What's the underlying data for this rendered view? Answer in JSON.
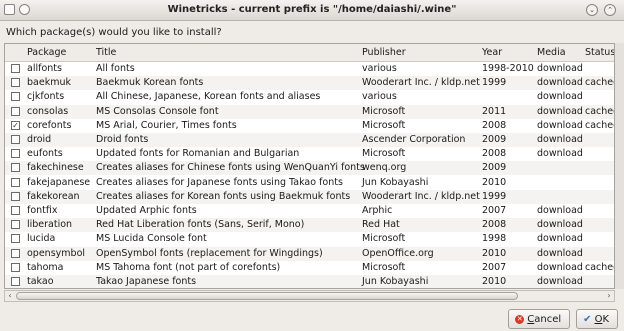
{
  "window": {
    "title": "Winetricks - current prefix is \"/home/daiashi/.wine\""
  },
  "prompt": "Which package(s) would you like to install?",
  "columns": {
    "package": "Package",
    "title": "Title",
    "publisher": "Publisher",
    "year": "Year",
    "media": "Media",
    "status": "Status"
  },
  "rows": [
    {
      "checked": false,
      "package": "allfonts",
      "title": "All fonts",
      "publisher": "various",
      "year": "1998-2010",
      "media": "download",
      "status": ""
    },
    {
      "checked": false,
      "package": "baekmuk",
      "title": "Baekmuk Korean fonts",
      "publisher": "Wooderart Inc. / kldp.net",
      "year": "1999",
      "media": "download",
      "status": "cached"
    },
    {
      "checked": false,
      "package": "cjkfonts",
      "title": "All Chinese, Japanese, Korean fonts and aliases",
      "publisher": "various",
      "year": "",
      "media": "download",
      "status": ""
    },
    {
      "checked": false,
      "package": "consolas",
      "title": "MS Consolas Console font",
      "publisher": "Microsoft",
      "year": "2011",
      "media": "download",
      "status": "cached"
    },
    {
      "checked": true,
      "package": "corefonts",
      "title": "MS Arial, Courier, Times fonts",
      "publisher": "Microsoft",
      "year": "2008",
      "media": "download",
      "status": "cached"
    },
    {
      "checked": false,
      "package": "droid",
      "title": "Droid fonts",
      "publisher": "Ascender Corporation",
      "year": "2009",
      "media": "download",
      "status": ""
    },
    {
      "checked": false,
      "package": "eufonts",
      "title": "Updated fonts for Romanian and Bulgarian",
      "publisher": "Microsoft",
      "year": "2008",
      "media": "download",
      "status": ""
    },
    {
      "checked": false,
      "package": "fakechinese",
      "title": "Creates aliases for Chinese fonts using WenQuanYi fonts",
      "publisher": "wenq.org",
      "year": "2009",
      "media": "",
      "status": ""
    },
    {
      "checked": false,
      "package": "fakejapanese",
      "title": "Creates aliases for Japanese fonts using Takao fonts",
      "publisher": "Jun Kobayashi",
      "year": "2010",
      "media": "",
      "status": ""
    },
    {
      "checked": false,
      "package": "fakekorean",
      "title": "Creates aliases for Korean fonts using Baekmuk fonts",
      "publisher": "Wooderart Inc. / kldp.net",
      "year": "1999",
      "media": "",
      "status": ""
    },
    {
      "checked": false,
      "package": "fontfix",
      "title": "Updated Arphic fonts",
      "publisher": "Arphic",
      "year": "2007",
      "media": "download",
      "status": ""
    },
    {
      "checked": false,
      "package": "liberation",
      "title": "Red Hat Liberation fonts (Sans, Serif, Mono)",
      "publisher": "Red Hat",
      "year": "2008",
      "media": "download",
      "status": ""
    },
    {
      "checked": false,
      "package": "lucida",
      "title": "MS Lucida Console font",
      "publisher": "Microsoft",
      "year": "1998",
      "media": "download",
      "status": ""
    },
    {
      "checked": false,
      "package": "opensymbol",
      "title": "OpenSymbol fonts (replacement for Wingdings)",
      "publisher": "OpenOffice.org",
      "year": "2010",
      "media": "download",
      "status": ""
    },
    {
      "checked": false,
      "package": "tahoma",
      "title": "MS Tahoma font (not part of corefonts)",
      "publisher": "Microsoft",
      "year": "2007",
      "media": "download",
      "status": "cached"
    },
    {
      "checked": false,
      "package": "takao",
      "title": "Takao Japanese fonts",
      "publisher": "Jun Kobayashi",
      "year": "2010",
      "media": "download",
      "status": ""
    }
  ],
  "buttons": {
    "cancel_prefix": "",
    "cancel_mnemonic": "C",
    "cancel_rest": "ancel",
    "ok_prefix": "",
    "ok_mnemonic": "O",
    "ok_rest": "K"
  },
  "icons": {
    "cancel": "cancel-icon",
    "ok": "checkmark-icon"
  }
}
